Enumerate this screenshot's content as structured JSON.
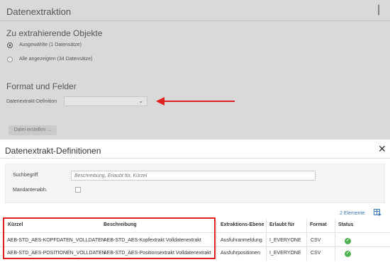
{
  "background_dialog": {
    "title": "Datenextraktion",
    "close_glyph": "|",
    "section_objects": "Zu extrahierende Objekte",
    "radio_selected": "Ausgewählte (1 Datensätze)",
    "radio_all": "Alle angezeigten (34 Datensätze)",
    "section_format": "Format und Felder",
    "definition_label": "Datenextrakt-Definition",
    "definition_value": "",
    "create_button": "Datei erstellen ..."
  },
  "dialog": {
    "title": "Datenextrakt-Definitionen",
    "close_glyph": "✕"
  },
  "filter": {
    "search_label": "Suchbegriff",
    "search_placeholder": "Beschreibung, Erlaubt für, Kürzel",
    "client_label": "Mandantenabh."
  },
  "result_count": "2 Elemente",
  "table": {
    "columns": [
      "Kürzel",
      "Beschreibung",
      "Extraktions-Ebene",
      "Erlaubt für",
      "Format",
      "Status"
    ],
    "rows": [
      {
        "kuerzel": "AEB-STD_AES-KOPFDATEN_VOLLDATEN",
        "beschreibung": "AEB-STD_AES-Kopfextrakt Volldatenextrakt",
        "ebene": "Ausfuhranmeldung",
        "erlaubt": "I_EVERYONE",
        "format": "CSV",
        "status": "ok"
      },
      {
        "kuerzel": "AEB-STD_AES-POSITIONEN_VOLLDATEN",
        "beschreibung": "AEB-STD_AES-Positionsextrakt Volldatenextrakt",
        "ebene": "Ausfuhrpositionen",
        "erlaubt": "I_EVERYONE",
        "format": "CSV",
        "status": "ok"
      }
    ]
  },
  "colors": {
    "highlight": "#e02020",
    "status_ok": "#4caf50",
    "link": "#3a7ab7"
  },
  "icons": {
    "status": "check-circle-icon",
    "export": "table-export-icon",
    "close": "close-icon",
    "dropdown": "chevron-down-icon"
  }
}
